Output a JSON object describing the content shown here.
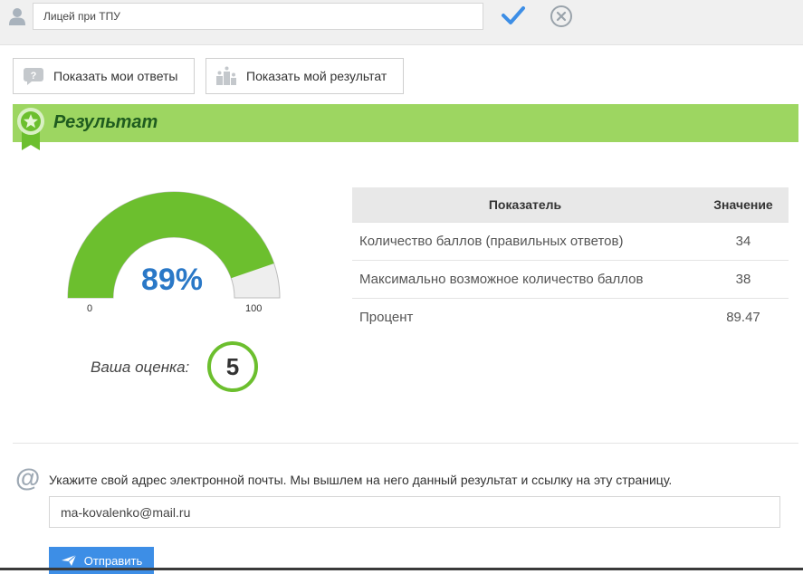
{
  "topbar": {
    "name_value": "Лицей при ТПУ",
    "icons": {
      "user": "user-icon",
      "confirm": "checkmark-icon",
      "cancel": "close-circle-icon"
    },
    "colors": {
      "confirm": "#3d8ee6",
      "cancel": "#9aa3ab"
    }
  },
  "buttons": {
    "show_answers": "Показать мои ответы",
    "show_result": "Показать мой результат"
  },
  "result": {
    "title": "Результат",
    "header_color": "#9dd661"
  },
  "gauge": {
    "value_text": "89%",
    "value": 89.47,
    "min": "0",
    "max": "100",
    "fill_color": "#6cbf2e",
    "track_color": "#eeeeee"
  },
  "grade": {
    "label": "Ваша оценка:",
    "value": "5"
  },
  "table": {
    "headers": [
      "Показатель",
      "Значение"
    ],
    "rows": [
      {
        "label": "Количество баллов (правильных ответов)",
        "value": "34"
      },
      {
        "label": "Максимально возможное количество баллов",
        "value": "38"
      },
      {
        "label": "Процент",
        "value": "89.47"
      }
    ]
  },
  "email": {
    "hint": "Укажите свой адрес электронной почты. Мы вышлем на него данный результат и ссылку на эту страницу.",
    "value": "ma-kovalenko@mail.ru",
    "send_label": "Отправить"
  }
}
